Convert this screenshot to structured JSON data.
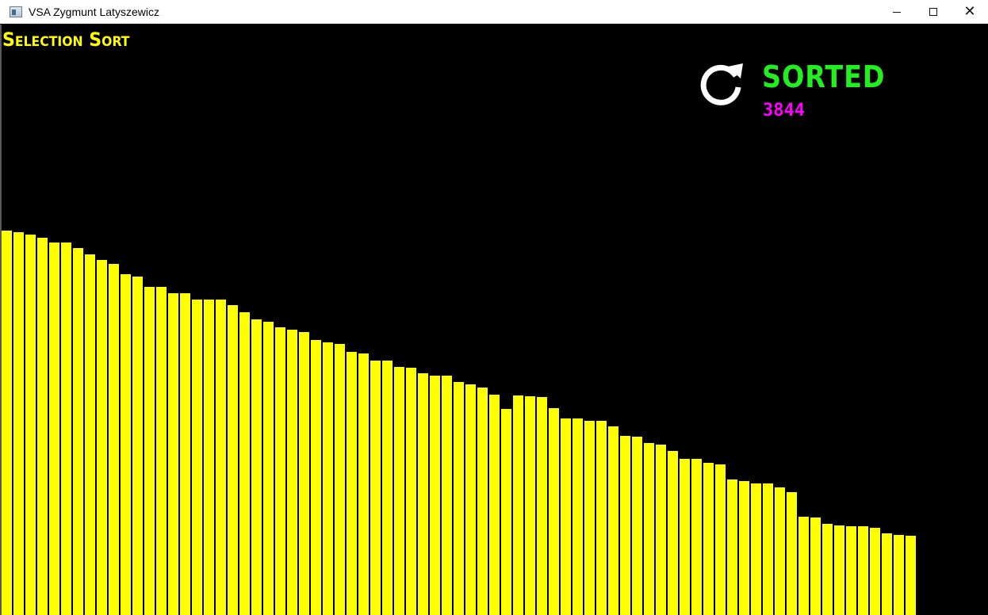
{
  "window": {
    "title": "VSA Zygmunt Latyszewicz",
    "icon": "app-window-icon",
    "controls": {
      "minimize": "minimize",
      "maximize": "maximize",
      "close": "close"
    }
  },
  "visualizer": {
    "algorithm_title": "Selection Sort",
    "status": "SORTED",
    "operation_count": "3844",
    "reset_icon": "refresh-icon",
    "colors": {
      "background": "#000000",
      "bars": "#ffff00",
      "title": "#ffff00",
      "status": "#22ee22",
      "counter": "#ff00ff",
      "reset_icon": "#ffffff"
    }
  },
  "chart_data": {
    "type": "bar",
    "order": "descending",
    "values": [
      485,
      483,
      480,
      476,
      470,
      470,
      463,
      455,
      448,
      443,
      430,
      427,
      414,
      414,
      406,
      406,
      398,
      398,
      398,
      391,
      382,
      373,
      370,
      363,
      360,
      357,
      347,
      344,
      342,
      332,
      330,
      321,
      321,
      313,
      312,
      305,
      302,
      302,
      294,
      291,
      287,
      278,
      260,
      277,
      276,
      275,
      261,
      248,
      248,
      245,
      245,
      238,
      226,
      225,
      217,
      215,
      207,
      197,
      197,
      192,
      190,
      171,
      169,
      166,
      166,
      161,
      155,
      124,
      123,
      115,
      113,
      112,
      112,
      110,
      103,
      101,
      100
    ]
  }
}
